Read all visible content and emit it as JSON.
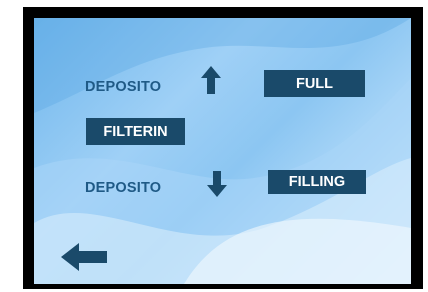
{
  "screen": {
    "deposit_upper_label": "DEPOSITO",
    "deposit_upper_status": "FULL",
    "filter_label": "FILTERIN",
    "deposit_lower_label": "DEPOSITO",
    "deposit_lower_status": "FILLING"
  },
  "icons": {
    "upper_arrow": "arrow-up-icon",
    "lower_arrow": "arrow-down-icon",
    "back": "back-arrow-icon"
  },
  "colors": {
    "label_text": "#1f5a86",
    "status_box": "#1a4a6a",
    "arrow": "#1a4a6a",
    "bezel": "#000000"
  }
}
